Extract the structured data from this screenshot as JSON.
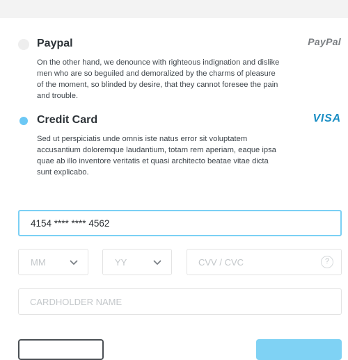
{
  "payment": {
    "paypal": {
      "title": "Paypal",
      "logo": "PayPal",
      "description": "On the other hand, we denounce with righteous indignation and dislike men who are so beguiled and demoralized by the charms of pleasure of the moment, so blinded by desire, that they cannot foresee the pain and trouble.",
      "selected": false
    },
    "card": {
      "title": "Credit Card",
      "logo": "VISA",
      "description": "Sed ut perspiciatis unde omnis iste natus error sit voluptatem accusantium doloremque laudantium, totam rem aperiam, eaque ipsa quae ab illo inventore veritatis et quasi architecto beatae vitae dicta sunt explicabo.",
      "selected": true
    }
  },
  "form": {
    "card_number_value": "4154 **** **** 4562",
    "month_placeholder": "MM",
    "year_placeholder": "YY",
    "cvv_placeholder": "CVV / CVC",
    "cvv_help": "?",
    "holder_placeholder": "CARDHOLDER NAME"
  },
  "colors": {
    "accent": "#6cc8f5",
    "focus_border": "#7bd0f4",
    "visa_blue": "#1a8ec4"
  },
  "icons": {
    "select_chevron": "chevron-down-icon",
    "cvv_help": "question-mark-icon"
  }
}
